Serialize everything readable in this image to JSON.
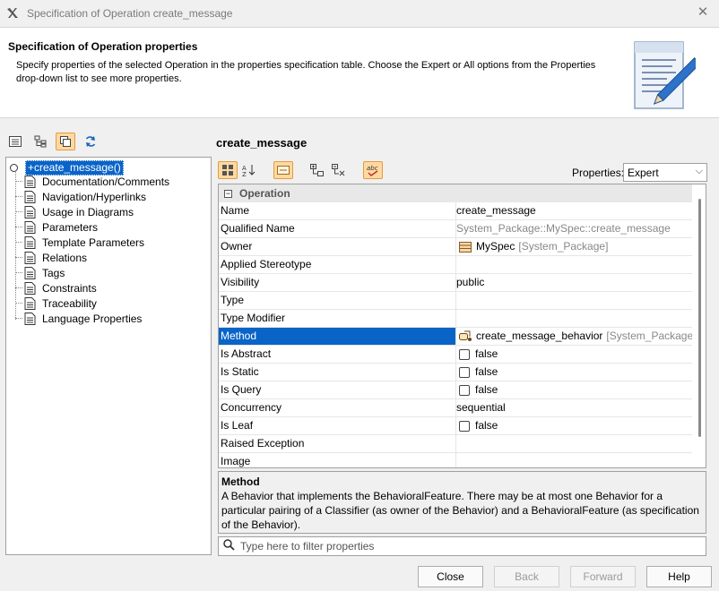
{
  "window": {
    "title": "Specification of Operation create_message"
  },
  "header": {
    "title": "Specification of Operation properties",
    "description": "Specify properties of the selected Operation in the properties specification table. Choose the Expert or All options from the Properties drop-down list to see more properties."
  },
  "tree": {
    "root_prefix": "+",
    "root": "create_message()",
    "items": [
      {
        "label": "Documentation/Comments"
      },
      {
        "label": "Navigation/Hyperlinks"
      },
      {
        "label": "Usage in Diagrams"
      },
      {
        "label": "Parameters"
      },
      {
        "label": "Template Parameters"
      },
      {
        "label": "Relations"
      },
      {
        "label": "Tags"
      },
      {
        "label": "Constraints"
      },
      {
        "label": "Traceability"
      },
      {
        "label": "Language Properties"
      }
    ]
  },
  "main": {
    "title": "create_message",
    "properties_label": "Properties:",
    "properties_value": "Expert",
    "group": "Operation",
    "rows": [
      {
        "name": "Name",
        "value": "create_message"
      },
      {
        "name": "Qualified Name",
        "value": "System_Package::MySpec::create_message"
      },
      {
        "name": "Owner",
        "value": "MySpec",
        "extra": "[System_Package]"
      },
      {
        "name": "Applied Stereotype",
        "value": ""
      },
      {
        "name": "Visibility",
        "value": "public"
      },
      {
        "name": "Type",
        "value": ""
      },
      {
        "name": "Type Modifier",
        "value": ""
      },
      {
        "name": "Method",
        "value": "create_message_behavior",
        "extra": "[System_Package::M"
      },
      {
        "name": "Is Abstract",
        "value": "false"
      },
      {
        "name": "Is Static",
        "value": "false"
      },
      {
        "name": "Is Query",
        "value": "false"
      },
      {
        "name": "Concurrency",
        "value": "sequential"
      },
      {
        "name": "Is Leaf",
        "value": "false"
      },
      {
        "name": "Raised Exception",
        "value": ""
      },
      {
        "name": "Image",
        "value": ""
      }
    ],
    "description_title": "Method",
    "description_text": "A Behavior that implements the BehavioralFeature. There may be at most one Behavior for a particular pairing of a Classifier (as owner of the Behavior) and a BehavioralFeature (as specification of the Behavior).",
    "filter_placeholder": "Type here to filter properties"
  },
  "buttons": {
    "close": "Close",
    "back": "Back",
    "forward": "Forward",
    "help": "Help"
  },
  "colors": {
    "selection": "#0a64c8",
    "toggle_active": "#ffd9a0"
  }
}
